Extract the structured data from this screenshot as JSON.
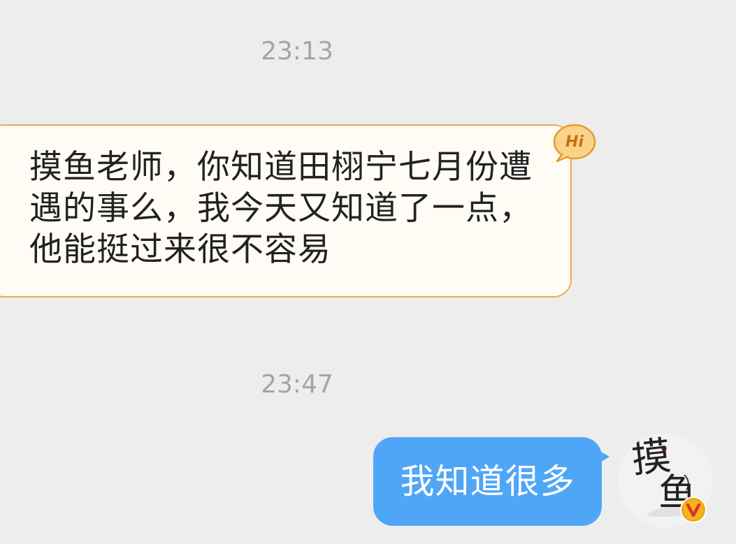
{
  "messages": [
    {
      "type": "timestamp",
      "text": "23:13"
    },
    {
      "type": "incoming",
      "text": "摸鱼老师，你知道田栩宁七月份遭遇的事么，我今天又知道了一点，他能挺过来很不容易",
      "badge": "Hi"
    },
    {
      "type": "timestamp",
      "text": "23:47"
    },
    {
      "type": "outgoing",
      "text": "我知道很多",
      "avatar_text": "摸鱼",
      "avatar_badge": "V"
    }
  ],
  "colors": {
    "background": "#ededed",
    "incoming_bubble": "#fffcf5",
    "incoming_border": "#eeaa50",
    "outgoing_bubble": "#4fa6f7",
    "timestamp": "#a4a4a4",
    "verified_badge": "#f0a818"
  },
  "icons": {
    "incoming_badge": "hi-speech-bubble-icon",
    "verified": "verified-v-badge-icon"
  }
}
